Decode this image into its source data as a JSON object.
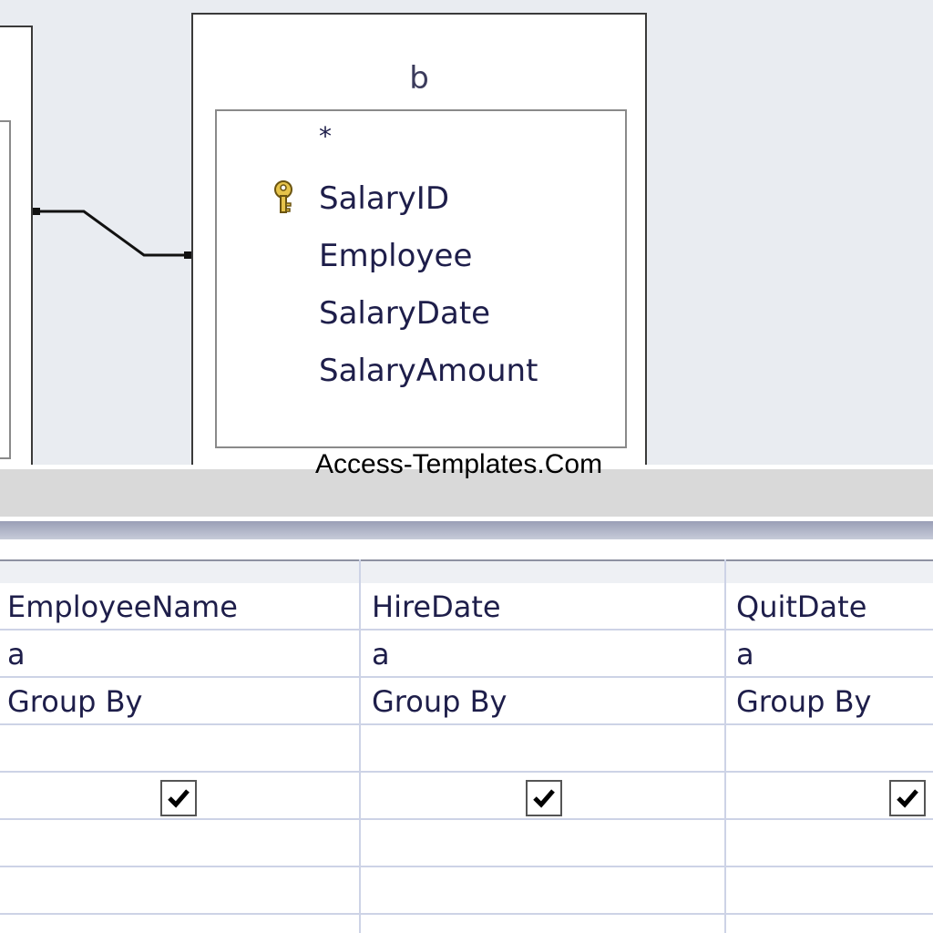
{
  "watermark": "Access-Templates.Com",
  "table_b": {
    "title": "b",
    "fields": [
      "*",
      "SalaryID",
      "Employee",
      "SalaryDate",
      "SalaryAmount"
    ],
    "primary_key_field": "SalaryID"
  },
  "grid": {
    "columns": [
      {
        "field": "EmployeeName",
        "table": "a",
        "total": "Group By",
        "show": true
      },
      {
        "field": "HireDate",
        "table": "a",
        "total": "Group By",
        "show": true
      },
      {
        "field": "QuitDate",
        "table": "a",
        "total": "Group By",
        "show": true
      }
    ]
  },
  "colors": {
    "design_background": "#e9ecf1",
    "grid_lines": "#cdd3e6",
    "text": "#1e1e4a"
  }
}
